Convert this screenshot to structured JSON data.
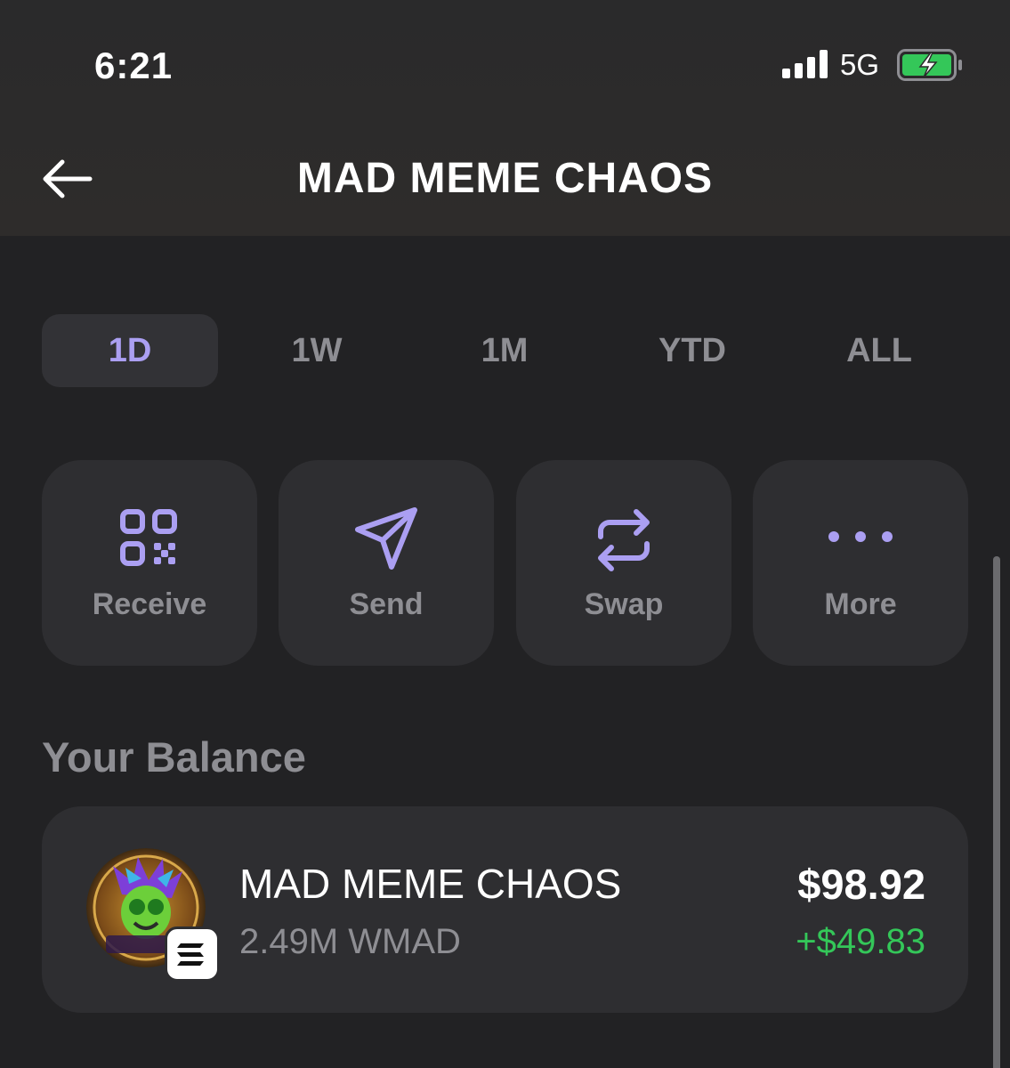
{
  "status_bar": {
    "time": "6:21",
    "network": "5G"
  },
  "nav": {
    "title": "MAD MEME CHAOS"
  },
  "range_tabs": [
    {
      "label": "1D",
      "active": true
    },
    {
      "label": "1W",
      "active": false
    },
    {
      "label": "1M",
      "active": false
    },
    {
      "label": "YTD",
      "active": false
    },
    {
      "label": "ALL",
      "active": false
    }
  ],
  "actions": [
    {
      "label": "Receive",
      "icon": "qr-code-icon"
    },
    {
      "label": "Send",
      "icon": "send-arrow-icon"
    },
    {
      "label": "Swap",
      "icon": "swap-arrows-icon"
    },
    {
      "label": "More",
      "icon": "more-dots-icon"
    }
  ],
  "balance": {
    "section_title": "Your Balance",
    "token_name": "MAD MEME CHAOS",
    "token_amount": "2.49M WMAD",
    "usd_value": "$98.92",
    "change": "+$49.83"
  },
  "colors": {
    "background": "#222224",
    "card": "#2e2e31",
    "accent_purple": "#ab9ff2",
    "muted_text": "#8e8e93",
    "positive_green": "#34c759",
    "battery_green": "#34c759"
  }
}
